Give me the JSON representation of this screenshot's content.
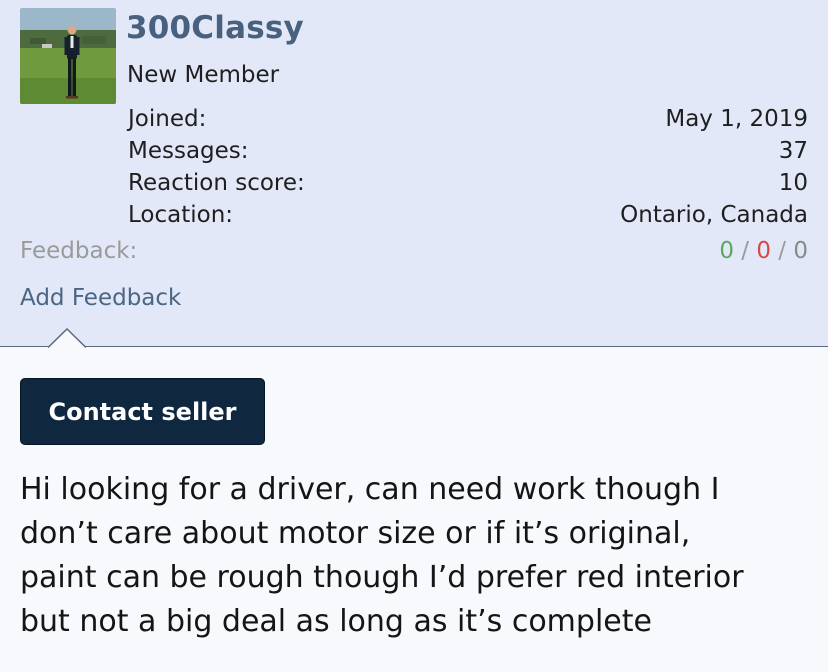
{
  "user": {
    "name": "300Classy",
    "title": "New Member",
    "stats": {
      "joined_label": "Joined:",
      "joined_value": "May 1, 2019",
      "messages_label": "Messages:",
      "messages_value": "37",
      "reaction_label": "Reaction score:",
      "reaction_value": "10",
      "location_label": "Location:",
      "location_value": "Ontario, Canada"
    },
    "feedback": {
      "label": "Feedback:",
      "positive": "0",
      "negative": "0",
      "neutral": "0",
      "separator": "/"
    },
    "add_feedback_label": "Add Feedback",
    "colors": {
      "block_bg": "#e3e8f8",
      "name": "#47617f",
      "positive": "#5ea85a",
      "negative": "#d64a45"
    }
  },
  "contact": {
    "button_label": "Contact seller",
    "button_color": "#0f2840"
  },
  "post": {
    "lines": [
      "Hi looking for a driver, can need work though I",
      "don’t care about motor size or if it’s original,",
      "paint can be rough though I’d prefer red interior",
      "but not a big deal as long as it’s complete"
    ]
  }
}
